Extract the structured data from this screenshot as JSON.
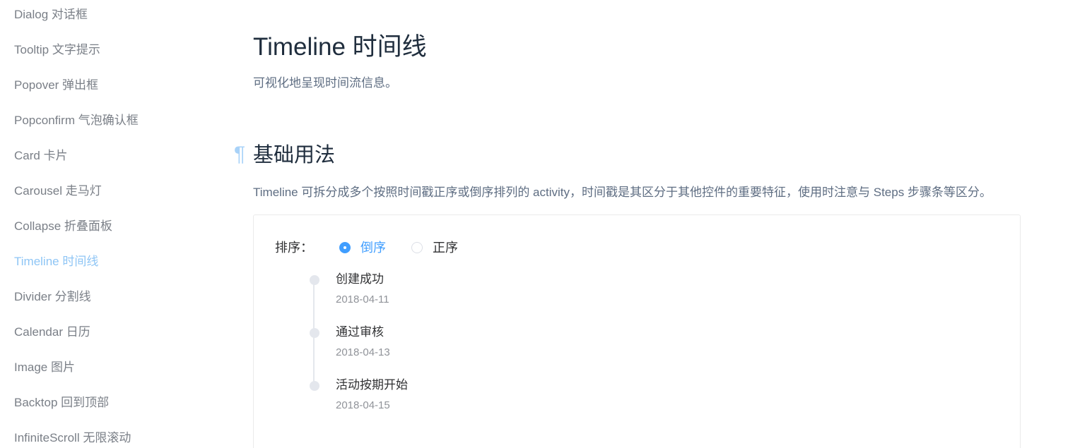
{
  "sidebar": {
    "items": [
      {
        "label": "Dialog 对话框",
        "active": false
      },
      {
        "label": "Tooltip 文字提示",
        "active": false
      },
      {
        "label": "Popover 弹出框",
        "active": false
      },
      {
        "label": "Popconfirm 气泡确认框",
        "active": false
      },
      {
        "label": "Card 卡片",
        "active": false
      },
      {
        "label": "Carousel 走马灯",
        "active": false
      },
      {
        "label": "Collapse 折叠面板",
        "active": false
      },
      {
        "label": "Timeline 时间线",
        "active": true
      },
      {
        "label": "Divider 分割线",
        "active": false
      },
      {
        "label": "Calendar 日历",
        "active": false
      },
      {
        "label": "Image 图片",
        "active": false
      },
      {
        "label": "Backtop 回到顶部",
        "active": false
      },
      {
        "label": "InfiniteScroll 无限滚动",
        "active": false
      }
    ]
  },
  "main": {
    "title": "Timeline 时间线",
    "description": "可视化地呈现时间流信息。",
    "section": {
      "anchor": "¶",
      "title": "基础用法",
      "description": "Timeline 可拆分成多个按照时间戳正序或倒序排列的 activity，时间戳是其区分于其他控件的重要特征，使用时注意与 Steps 步骤条等区分。"
    },
    "demo": {
      "sort_label": "排序：",
      "radios": [
        {
          "label": "倒序",
          "checked": true
        },
        {
          "label": "正序",
          "checked": false
        }
      ],
      "timeline": [
        {
          "content": "创建成功",
          "timestamp": "2018-04-11"
        },
        {
          "content": "通过审核",
          "timestamp": "2018-04-13"
        },
        {
          "content": "活动按期开始",
          "timestamp": "2018-04-15"
        }
      ]
    }
  },
  "colors": {
    "accent": "#409eff",
    "sidebar_active": "#8ec5f5",
    "sidebar_text": "#7a7f87",
    "heading": "#1f2d3d",
    "body_text": "#5e6d82",
    "timeline_node": "#e4e7ed",
    "timestamp": "#909399"
  }
}
